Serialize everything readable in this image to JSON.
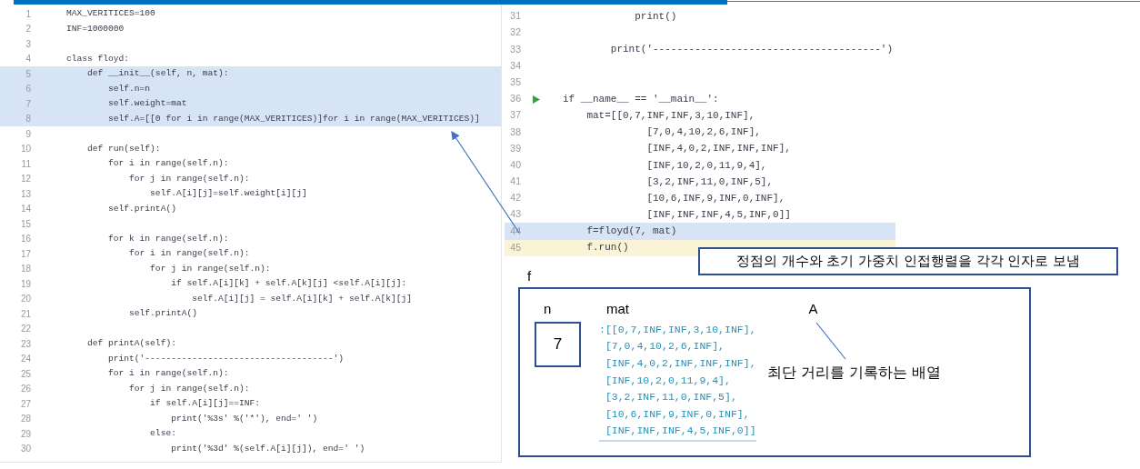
{
  "editor_left": {
    "lines": [
      {
        "number": "1",
        "code": "MAX_VERITICES=100",
        "selected": false
      },
      {
        "number": "2",
        "code": "INF=1000000",
        "selected": false
      },
      {
        "number": "3",
        "selected": false
      },
      {
        "number": "4",
        "code": "class floyd:",
        "selected": false
      },
      {
        "number": "5",
        "code": "    def __init__(self, n, mat):",
        "selected": true
      },
      {
        "number": "6",
        "code": "        self.n=n",
        "selected": true
      },
      {
        "number": "7",
        "code": "        self.weight=mat",
        "selected": true
      },
      {
        "number": "8",
        "code": "        self.A=[[0 for i in range(MAX_VERITICES)]for i in range(MAX_VERITICES)]",
        "selected": true
      },
      {
        "number": "9",
        "selected": false
      },
      {
        "number": "10",
        "code": "    def run(self):",
        "selected": false
      },
      {
        "number": "11",
        "code": "        for i in range(self.n):",
        "selected": false
      },
      {
        "number": "12",
        "code": "            for j in range(self.n):",
        "selected": false
      },
      {
        "number": "13",
        "code": "                self.A[i][j]=self.weight[i][j]",
        "selected": false
      },
      {
        "number": "14",
        "code": "        self.printA()",
        "selected": false
      },
      {
        "number": "15",
        "selected": false
      },
      {
        "number": "16",
        "code": "        for k in range(self.n):",
        "selected": false
      },
      {
        "number": "17",
        "code": "            for i in range(self.n):",
        "selected": false
      },
      {
        "number": "18",
        "code": "                for j in range(self.n):",
        "selected": false
      },
      {
        "number": "19",
        "code": "                    if self.A[i][k] + self.A[k][j] <self.A[i][j]:",
        "selected": false
      },
      {
        "number": "20",
        "code": "                        self.A[i][j] = self.A[i][k] + self.A[k][j]",
        "selected": false
      },
      {
        "number": "21",
        "code": "            self.printA()",
        "selected": false
      },
      {
        "number": "22",
        "selected": false
      },
      {
        "number": "23",
        "code": "    def printA(self):",
        "selected": false
      },
      {
        "number": "24",
        "code": "        print('------------------------------------')",
        "selected": false
      },
      {
        "number": "25",
        "code": "        for i in range(self.n):",
        "selected": false
      },
      {
        "number": "26",
        "code": "            for j in range(self.n):",
        "selected": false
      },
      {
        "number": "27",
        "code": "                if self.A[i][j]==INF:",
        "selected": false
      },
      {
        "number": "28",
        "code": "                    print('%3s' %('*'), end=' ')",
        "selected": false
      },
      {
        "number": "29",
        "code": "                else:",
        "selected": false
      },
      {
        "number": "30",
        "code": "                    print('%3d' %(self.A[i][j]), end=' ')",
        "selected": false
      }
    ]
  },
  "editor_right": {
    "lines": [
      {
        "number": "31",
        "code": "            print()",
        "selected": false,
        "current": false,
        "run": false
      },
      {
        "number": "32",
        "selected": false,
        "current": false,
        "run": false
      },
      {
        "number": "33",
        "code": "        print('--------------------------------------')",
        "selected": false,
        "current": false,
        "run": false
      },
      {
        "number": "34",
        "selected": false,
        "current": false,
        "run": false
      },
      {
        "number": "35",
        "selected": false,
        "current": false,
        "run": false
      },
      {
        "number": "36",
        "code": "if __name__ == '__main__':",
        "selected": false,
        "current": false,
        "run": true
      },
      {
        "number": "37",
        "code": "    mat=[[0,7,INF,INF,3,10,INF],",
        "selected": false,
        "current": false,
        "run": false
      },
      {
        "number": "38",
        "code": "              [7,0,4,10,2,6,INF],",
        "selected": false,
        "current": false,
        "run": false
      },
      {
        "number": "39",
        "code": "              [INF,4,0,2,INF,INF,INF],",
        "selected": false,
        "current": false,
        "run": false
      },
      {
        "number": "40",
        "code": "              [INF,10,2,0,11,9,4],",
        "selected": false,
        "current": false,
        "run": false
      },
      {
        "number": "41",
        "code": "              [3,2,INF,11,0,INF,5],",
        "selected": false,
        "current": false,
        "run": false
      },
      {
        "number": "42",
        "code": "              [10,6,INF,9,INF,0,INF],",
        "selected": false,
        "current": false,
        "run": false
      },
      {
        "number": "43",
        "code": "              [INF,INF,INF,4,5,INF,0]]",
        "selected": false,
        "current": false,
        "run": false
      },
      {
        "number": "44",
        "code": "    f=floyd(7, mat)",
        "selected": true,
        "current": false,
        "run": false
      },
      {
        "number": "45",
        "code": "    f.run()",
        "selected": false,
        "current": true,
        "run": false
      }
    ]
  },
  "callout": {
    "text": "정점의 개수와 초기 가중치 인접행렬을 각각 인자로 보냄"
  },
  "diagram": {
    "object_label": "f",
    "n_label": "n",
    "n_value": "7",
    "mat_label": "mat",
    "mat_lines": [
      ":[[0,7,INF,INF,3,10,INF],",
      " [7,0,4,10,2,6,INF],",
      " [INF,4,0,2,INF,INF,INF],",
      " [INF,10,2,0,11,9,4],",
      " [3,2,INF,11,0,INF,5],",
      " [10,6,INF,9,INF,0,INF],",
      " [INF,INF,INF,4,5,INF,0]]"
    ],
    "a_label": "A",
    "a_note": "최단 거리를 기록하는 배열"
  }
}
